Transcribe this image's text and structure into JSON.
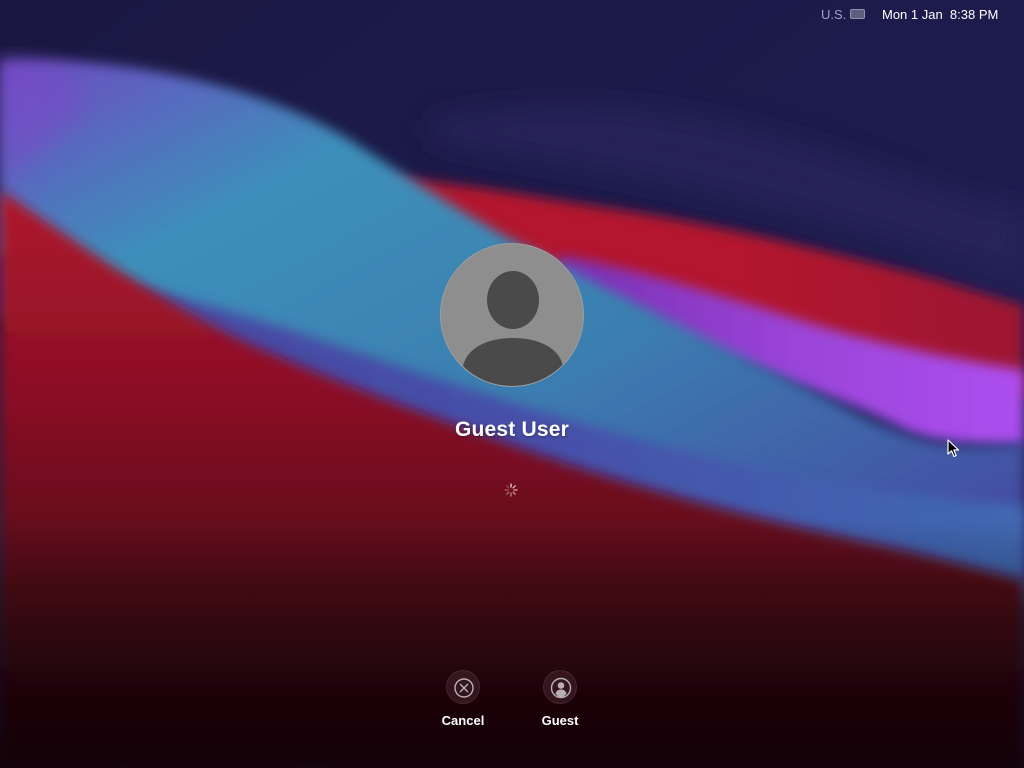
{
  "menubar": {
    "input_source": "U.S.",
    "datetime": "Mon 1 Jan  8:38 PM",
    "icons": [
      "keyboard-icon"
    ]
  },
  "login": {
    "user_name": "Guest User",
    "avatar_icon": "person-silhouette-icon",
    "status_icon": "loading-spinner-icon"
  },
  "actions": {
    "cancel_label": "Cancel",
    "cancel_icon": "close-circle-icon",
    "guest_label": "Guest",
    "guest_icon": "person-icon"
  },
  "colors": {
    "wallpaper_dark": "#1b1947",
    "wallpaper_teal": "#3a8fb8",
    "wallpaper_red": "#a51631",
    "wallpaper_purple": "#a64ae6",
    "avatar_bg": "#8e8e8e",
    "avatar_fg": "#4a4a4a"
  }
}
